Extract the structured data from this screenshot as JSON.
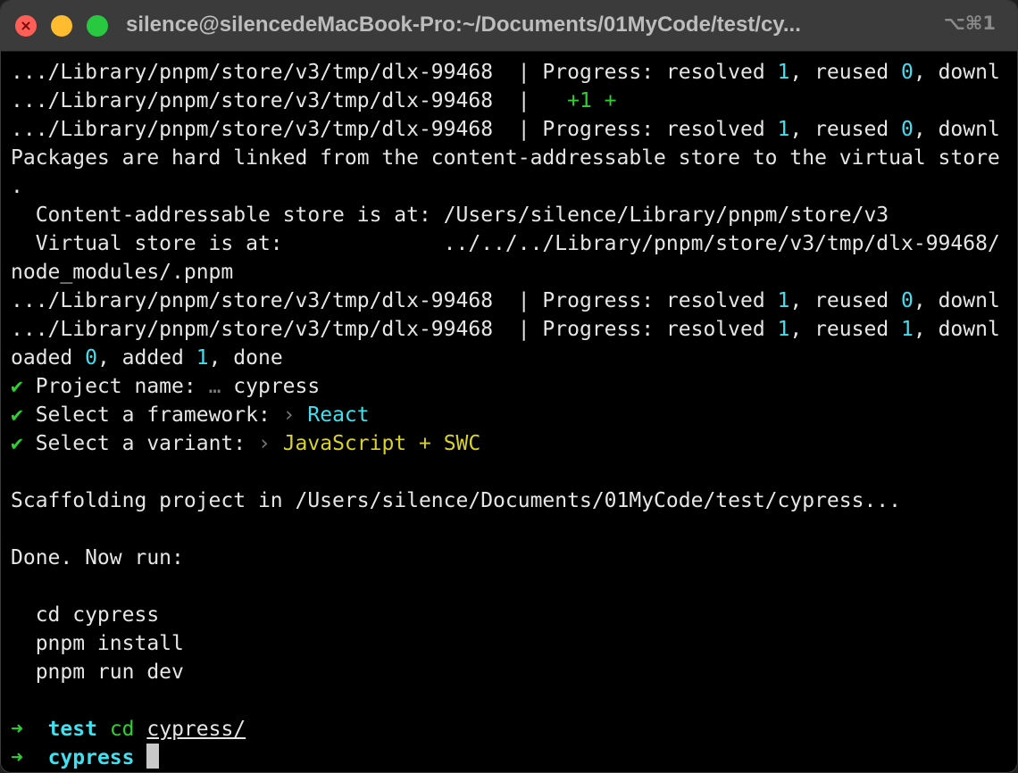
{
  "window": {
    "title": "silence@silencedeMacBook-Pro:~/Documents/01MyCode/test/cy...",
    "shortcut": "⌥⌘1"
  },
  "terminal": {
    "lines": [
      [
        {
          "t": ".../Library/pnpm/store/v3/tmp/dlx-99468  | Progress: resolved "
        },
        {
          "t": "1",
          "c": "cyan"
        },
        {
          "t": ", reused "
        },
        {
          "t": "0",
          "c": "cyan"
        },
        {
          "t": ", downl"
        }
      ],
      [
        {
          "t": ".../Library/pnpm/store/v3/tmp/dlx-99468  |   "
        },
        {
          "t": "+1 +",
          "c": "green"
        }
      ],
      [
        {
          "t": ".../Library/pnpm/store/v3/tmp/dlx-99468  | Progress: resolved "
        },
        {
          "t": "1",
          "c": "cyan"
        },
        {
          "t": ", reused "
        },
        {
          "t": "0",
          "c": "cyan"
        },
        {
          "t": ", downl"
        }
      ],
      [
        {
          "t": "Packages are hard linked from the content-addressable store to the virtual store"
        }
      ],
      [
        {
          "t": "."
        }
      ],
      [
        {
          "t": "  Content-addressable store is at: /Users/silence/Library/pnpm/store/v3"
        }
      ],
      [
        {
          "t": "  Virtual store is at:             ../../../Library/pnpm/store/v3/tmp/dlx-99468/"
        }
      ],
      [
        {
          "t": "node_modules/.pnpm"
        }
      ],
      [
        {
          "t": ".../Library/pnpm/store/v3/tmp/dlx-99468  | Progress: resolved "
        },
        {
          "t": "1",
          "c": "cyan"
        },
        {
          "t": ", reused "
        },
        {
          "t": "0",
          "c": "cyan"
        },
        {
          "t": ", downl"
        }
      ],
      [
        {
          "t": ".../Library/pnpm/store/v3/tmp/dlx-99468  | Progress: resolved "
        },
        {
          "t": "1",
          "c": "cyan"
        },
        {
          "t": ", reused "
        },
        {
          "t": "1",
          "c": "cyan"
        },
        {
          "t": ", downl"
        }
      ],
      [
        {
          "t": "oaded "
        },
        {
          "t": "0",
          "c": "cyan"
        },
        {
          "t": ", added "
        },
        {
          "t": "1",
          "c": "cyan"
        },
        {
          "t": ", done"
        }
      ],
      [
        {
          "t": "✔",
          "c": "green"
        },
        {
          "t": " Project name: "
        },
        {
          "t": "…",
          "c": "dim"
        },
        {
          "t": " cypress"
        }
      ],
      [
        {
          "t": "✔",
          "c": "green"
        },
        {
          "t": " Select a framework: "
        },
        {
          "t": "›",
          "c": "dim"
        },
        {
          "t": " "
        },
        {
          "t": "React",
          "c": "cyan"
        }
      ],
      [
        {
          "t": "✔",
          "c": "green"
        },
        {
          "t": " Select a variant: "
        },
        {
          "t": "›",
          "c": "dim"
        },
        {
          "t": " "
        },
        {
          "t": "JavaScript + SWC",
          "c": "yellow"
        }
      ],
      [
        {
          "t": ""
        }
      ],
      [
        {
          "t": "Scaffolding project in /Users/silence/Documents/01MyCode/test/cypress..."
        }
      ],
      [
        {
          "t": ""
        }
      ],
      [
        {
          "t": "Done. Now run:"
        }
      ],
      [
        {
          "t": ""
        }
      ],
      [
        {
          "t": "  cd cypress"
        }
      ],
      [
        {
          "t": "  pnpm install"
        }
      ],
      [
        {
          "t": "  pnpm run dev"
        }
      ],
      [
        {
          "t": ""
        }
      ],
      [
        {
          "t": "➜",
          "c": "green"
        },
        {
          "t": "  "
        },
        {
          "t": "test",
          "c": "cyan bold"
        },
        {
          "t": " "
        },
        {
          "t": "cd",
          "c": "green"
        },
        {
          "t": " "
        },
        {
          "t": "cypress/",
          "c": "underline"
        }
      ],
      [
        {
          "t": "➜",
          "c": "green"
        },
        {
          "t": "  "
        },
        {
          "t": "cypress",
          "c": "cyan bold"
        },
        {
          "t": " "
        },
        {
          "cursor": true
        }
      ]
    ]
  },
  "colors": {
    "background": "#000000",
    "text": "#e6e6e6",
    "cyan": "#3fe0f0",
    "green": "#2fd12f",
    "yellow": "#d8d22a",
    "titlebar": "#3b3b3b"
  }
}
